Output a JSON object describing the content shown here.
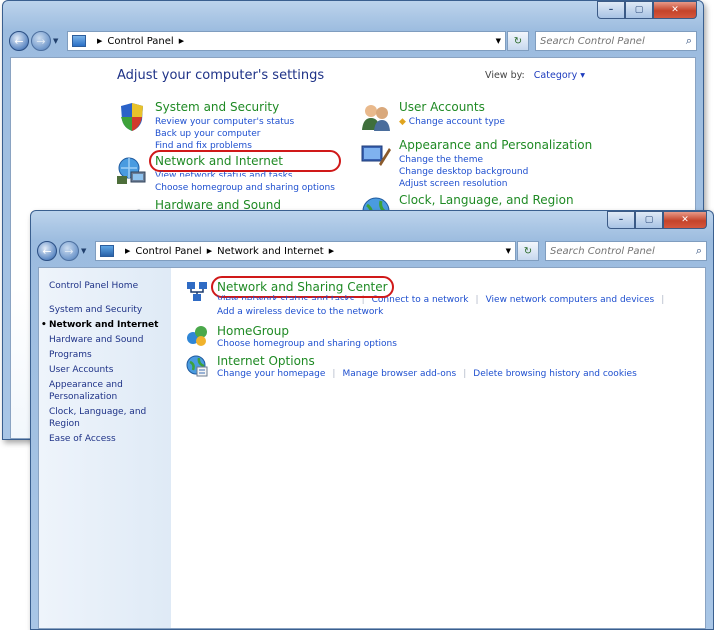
{
  "back_window": {
    "address": {
      "root": "Control Panel"
    },
    "search_placeholder": "Search Control Panel",
    "heading": "Adjust your computer's settings",
    "view_by_label": "View by:",
    "view_by_value": "Category",
    "categories": [
      {
        "title": "System and Security",
        "links": [
          "Review your computer's status",
          "Back up your computer",
          "Find and fix problems"
        ],
        "icon": "shield-icon"
      },
      {
        "title": "Network and Internet",
        "links": [
          "View network status and tasks",
          "Choose homegroup and sharing options"
        ],
        "icon": "network-icon"
      },
      {
        "title": "Hardware and Sound",
        "links": [],
        "icon": "printer-icon"
      },
      {
        "title": "User Accounts",
        "links": [
          "Change account type"
        ],
        "icon": "users-icon"
      },
      {
        "title": "Appearance and Personalization",
        "links": [
          "Change the theme",
          "Change desktop background",
          "Adjust screen resolution"
        ],
        "icon": "monitor-brush-icon"
      },
      {
        "title": "Clock, Language, and Region",
        "links": [],
        "icon": "globe-clock-icon"
      }
    ]
  },
  "front_window": {
    "address": {
      "root": "Control Panel",
      "current": "Network and Internet"
    },
    "search_placeholder": "Search Control Panel",
    "sidebar": {
      "home": "Control Panel Home",
      "items": [
        "System and Security",
        "Network and Internet",
        "Hardware and Sound",
        "Programs",
        "User Accounts",
        "Appearance and Personalization",
        "Clock, Language, and Region",
        "Ease of Access"
      ],
      "current_index": 1
    },
    "tasks": [
      {
        "title": "Network and Sharing Center",
        "icon": "network-sharing-icon",
        "links": [
          "View network status and tasks",
          "Connect to a network",
          "View network computers and devices",
          "Add a wireless device to the network"
        ]
      },
      {
        "title": "HomeGroup",
        "icon": "homegroup-icon",
        "links": [
          "Choose homegroup and sharing options"
        ]
      },
      {
        "title": "Internet Options",
        "icon": "internet-options-icon",
        "links": [
          "Change your homepage",
          "Manage browser add-ons",
          "Delete browsing history and cookies"
        ]
      }
    ]
  },
  "colors": {
    "title_green": "#1f8a24",
    "link_blue": "#1e4fcf",
    "highlight_red": "#d01919",
    "chrome_blue": "#a9c6e6"
  }
}
